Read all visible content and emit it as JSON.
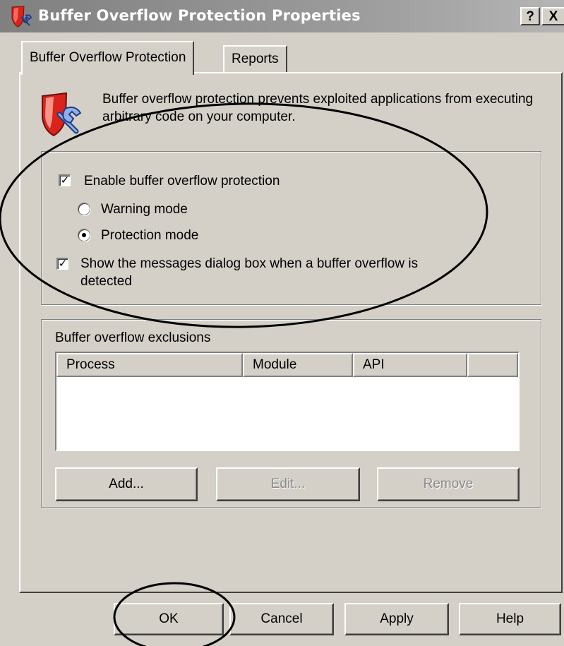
{
  "window": {
    "title": "Buffer Overflow Protection Properties",
    "help_button": "?",
    "close_button": "X"
  },
  "tabs": [
    {
      "label": "Buffer Overflow Protection",
      "selected": true
    },
    {
      "label": "Reports",
      "selected": false
    }
  ],
  "description": "Buffer overflow protection prevents exploited applications from executing arbitrary code on your computer.",
  "options": {
    "enable_label": "Enable buffer overflow protection",
    "enable_checked": true,
    "mode_warning_label": "Warning mode",
    "mode_protection_label": "Protection mode",
    "selected_mode": "Protection mode",
    "show_messages_label_line1": "Show the messages dialog box when a buffer overflow is",
    "show_messages_label_line2": "detected",
    "show_messages_checked": true
  },
  "exclusions": {
    "title": "Buffer overflow exclusions",
    "columns": [
      "Process",
      "Module",
      "API",
      ""
    ],
    "rows": [],
    "add_button": "Add...",
    "edit_button": "Edit...",
    "remove_button": "Remove"
  },
  "footer": {
    "ok": "OK",
    "cancel": "Cancel",
    "apply": "Apply",
    "help": "Help"
  },
  "colors": {
    "face": "#d4d0c8",
    "inactive_title": "#808080",
    "annotation": "#000000"
  }
}
